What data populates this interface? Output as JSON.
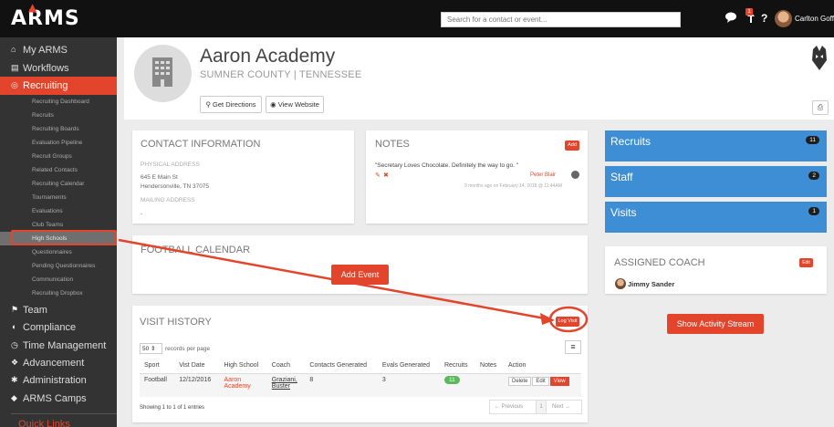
{
  "app": {
    "logo_text": "ARMS",
    "logo_hat": "▲"
  },
  "topbar": {
    "search_placeholder": "Search for a contact or event...",
    "notification_count": "1",
    "username": "Carlton Goff"
  },
  "sidebar": {
    "items": [
      {
        "label": "My ARMS",
        "icon": "home-icon",
        "glyph": "⌂"
      },
      {
        "label": "Workflows",
        "icon": "clipboard-icon",
        "glyph": "▤"
      },
      {
        "label": "Recruiting",
        "icon": "target-icon",
        "glyph": "◎",
        "active": true
      }
    ],
    "recruiting_sub": [
      "Recruiting Dashboard",
      "Recruits",
      "Recruiting Boards",
      "Evaluation Pipeline",
      "Recruit Groups",
      "Related Contacts",
      "Recruiting Calendar",
      "Tournaments",
      "Evaluations",
      "Club Teams",
      "High Schools",
      "Questionnaires",
      "Pending Questionnaires",
      "Communication",
      "Recruiting Dropbox"
    ],
    "highlighted_sub": "High Schools",
    "items_after": [
      {
        "label": "Team",
        "icon": "flag-icon",
        "glyph": "⚑"
      },
      {
        "label": "Compliance",
        "icon": "shield-icon",
        "glyph": "◖"
      },
      {
        "label": "Time Management",
        "icon": "clock-icon",
        "glyph": "◷"
      },
      {
        "label": "Advancement",
        "icon": "handshake-icon",
        "glyph": "❖"
      },
      {
        "label": "Administration",
        "icon": "gear-icon",
        "glyph": "✱"
      },
      {
        "label": "ARMS Camps",
        "icon": "diamond-icon",
        "glyph": "◆"
      }
    ],
    "quick_links": "Quick Links"
  },
  "school": {
    "name": "Aaron Academy",
    "location": "SUMNER COUNTY  |  TENNESSEE",
    "directions_btn": "Get Directions",
    "website_btn": "View Website"
  },
  "contact": {
    "title": "CONTACT INFORMATION",
    "physical_label": "PHYSICAL ADDRESS",
    "address_line1": "645 E Main St",
    "address_line2": "Hendersonville, TN 37075",
    "mailing_label": "MAILING ADDRESS",
    "mailing_value": "-"
  },
  "notes": {
    "title": "NOTES",
    "add_btn": "Add",
    "note_text": "\"Secretary Loves Chocolate. Definitely the way to go. \"",
    "author": "Peter Blair",
    "timestamp": "9 months ago on February 14, 2018 @ 11:44AM"
  },
  "calendar": {
    "title": "FOOTBALL CALENDAR",
    "add_event_btn": "Add Event"
  },
  "visit_history": {
    "title": "VISIT HISTORY",
    "log_visit_btn": "Log Visit",
    "page_size": "50",
    "records_label": "records per page",
    "columns": [
      "Sport",
      "Vist Date",
      "High School",
      "Coach",
      "Contacts Generated",
      "Evals Generated",
      "Recruits",
      "Notes",
      "Action"
    ],
    "rows": [
      {
        "sport": "Football",
        "date": "12/12/2016",
        "school_line1": "Aaron",
        "school_line2": "Academy",
        "coach_line1": "Graziani,",
        "coach_line2": "Buster",
        "contacts": "8",
        "evals": "3",
        "recruits": "11",
        "notes": "",
        "actions": [
          "Delete",
          "Edit",
          "View"
        ]
      }
    ],
    "showing": "Showing 1 to 1 of 1 entries",
    "pager": {
      "prev": "← Previous",
      "page": "1",
      "next": "Next →"
    }
  },
  "right_panels": [
    {
      "label": "Recruits",
      "count": "11"
    },
    {
      "label": "Staff",
      "count": "2"
    },
    {
      "label": "Visits",
      "count": "1"
    }
  ],
  "assigned_coach": {
    "title": "ASSIGNED COACH",
    "edit_btn": "Edit",
    "coach_name": "Jimmy Sander"
  },
  "activity_btn": "Show Activity Stream",
  "colors": {
    "accent": "#e2452b",
    "blue": "#3d8ed4",
    "sidebar": "#333333",
    "topbar": "#111111"
  }
}
